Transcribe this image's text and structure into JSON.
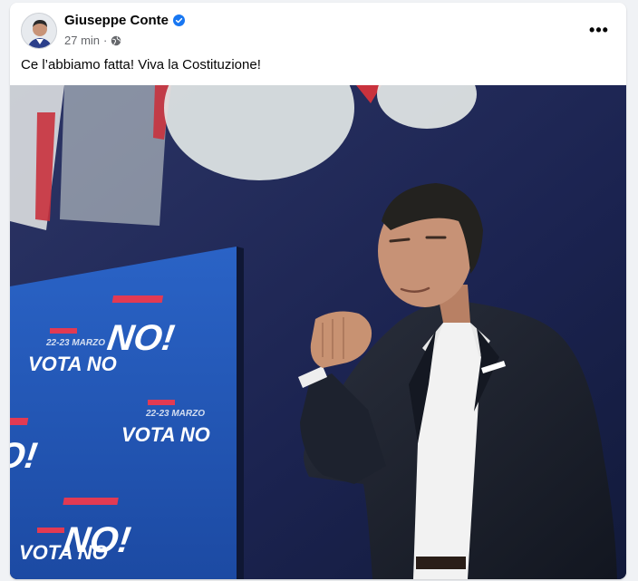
{
  "post": {
    "author": "Giuseppe Conte",
    "time": "27 min",
    "separator": "·",
    "text": "Ce l’abbiamo fatta! Viva la Costituzione!",
    "more_label": "•••"
  },
  "photo": {
    "signs": [
      {
        "line1": "22-23 MARZO",
        "line2": "VOTA NO"
      },
      {
        "line1": "",
        "line2": "NO!"
      },
      {
        "line1": "",
        "line2": "NO!"
      },
      {
        "line1": "22-23 MARZO",
        "line2": "VOTA NO"
      },
      {
        "line1": "",
        "line2": "NO!"
      },
      {
        "line1": "",
        "line2": "VOTA NO"
      }
    ]
  },
  "colors": {
    "accent_blue": "#1877f2",
    "text_primary": "#050505",
    "text_secondary": "#65676b"
  }
}
